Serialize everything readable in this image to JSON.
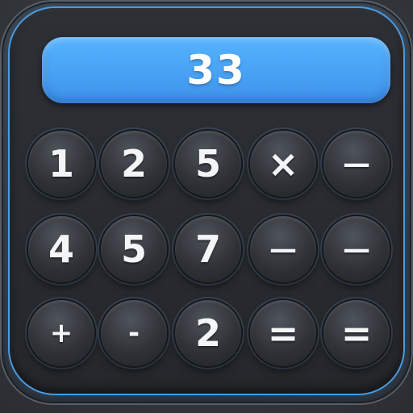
{
  "display": {
    "value": "33"
  },
  "keys": [
    {
      "label": "1",
      "name": "key-1"
    },
    {
      "label": "2",
      "name": "key-2"
    },
    {
      "label": "5",
      "name": "key-5"
    },
    {
      "label": "×",
      "name": "key-multiply"
    },
    {
      "label": "—",
      "name": "key-minus"
    },
    {
      "label": "4",
      "name": "key-4"
    },
    {
      "label": "5",
      "name": "key-5"
    },
    {
      "label": "7",
      "name": "key-7"
    },
    {
      "label": "—",
      "name": "key-minus"
    },
    {
      "label": "—",
      "name": "key-minus"
    },
    {
      "label": "+",
      "name": "key-plus"
    },
    {
      "label": "-",
      "name": "key-minus"
    },
    {
      "label": "2",
      "name": "key-2"
    },
    {
      "label": "=",
      "name": "key-equals"
    },
    {
      "label": "=",
      "name": "key-equals"
    }
  ],
  "colors": {
    "display": "#4aa3f5",
    "accent": "#4a9be0",
    "body": "#2a2d32"
  }
}
